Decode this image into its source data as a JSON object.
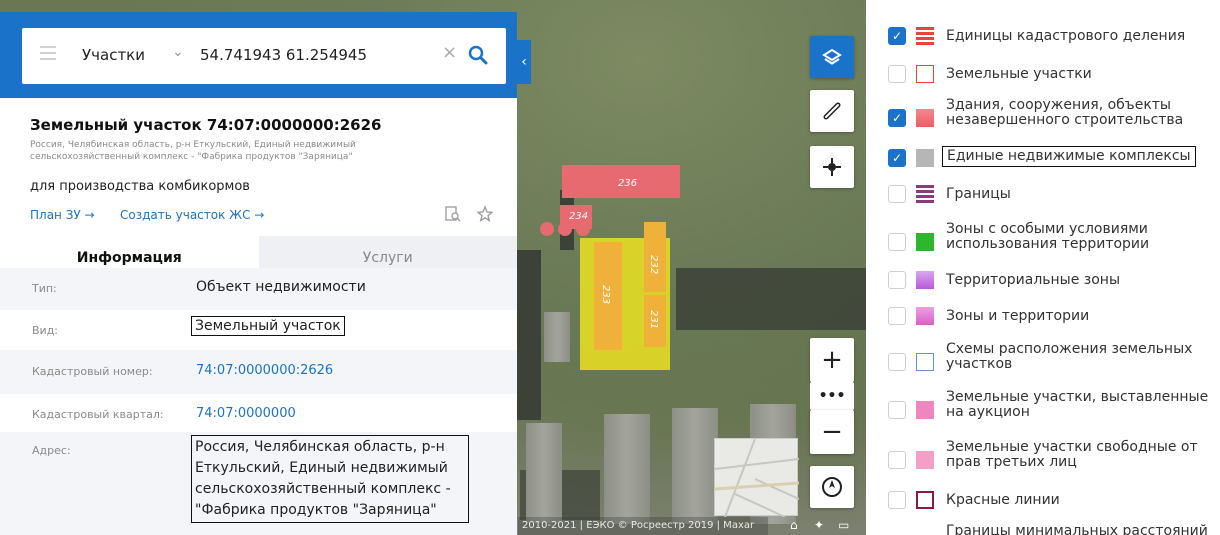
{
  "search": {
    "category": "Участки",
    "query": "54.741943 61.254945"
  },
  "object": {
    "title": "Земельный участок 74:07:0000000:2626",
    "address_short": "Россия, Челябинская область, р-н Еткульский, Единый недвижимый сельскохозяйственный комплекс - \"Фабрика продуктов \"Заряница\"",
    "purpose": "для производства комбикормов",
    "link_plan": "План ЗУ →",
    "link_create": "Создать участок ЖС →"
  },
  "tabs": [
    {
      "label": "Информация"
    },
    {
      "label": "Услуги"
    }
  ],
  "info": [
    {
      "label": "Тип:",
      "value": "Объект недвижимости"
    },
    {
      "label": "Вид:",
      "value": "Земельный участок"
    },
    {
      "label": "Кадастровый номер:",
      "value": "74:07:0000000:2626"
    },
    {
      "label": "Кадастровый квартал:",
      "value": "74:07:0000000"
    },
    {
      "label": "Адрес:",
      "value": "Россия, Челябинская область, р-н Еткульский, Единый недвижимый сельскохозяйственный комплекс - \"Фабрика продуктов \"Заряница\""
    }
  ],
  "map": {
    "labels": [
      "236",
      "234",
      "233",
      "232",
      "231"
    ],
    "attribution": "2010-2021 | ЕЭКО © Росреестр 2019 | Maxar"
  },
  "layers": [
    {
      "label": "Единицы кадастрового деления",
      "checked": true,
      "color": "#e8433d"
    },
    {
      "label": "Земельные участки",
      "checked": false,
      "color": "#e8433d"
    },
    {
      "label": "Здания, сооружения, объекты незавершенного строительства",
      "checked": true,
      "color": "#f05a63"
    },
    {
      "label": "Единые недвижимые комплексы",
      "checked": true,
      "color": "#b6b6b6"
    },
    {
      "label": "Границы",
      "checked": false,
      "color": "#8e3a7a"
    },
    {
      "label": "Зоны с особыми условиями использования территории",
      "checked": false,
      "color": "#2eb62e"
    },
    {
      "label": "Территориальные зоны",
      "checked": false,
      "color": "#b85ad9"
    },
    {
      "label": "Зоны и территории",
      "checked": false,
      "color": "#d662c8"
    },
    {
      "label": "Схемы расположения земельных участков",
      "checked": false,
      "color": "#6a8fd6"
    },
    {
      "label": "Земельные участки, выставленные на аукцион",
      "checked": false,
      "color": "#ef86bf"
    },
    {
      "label": "Земельные участки свободные от прав третьих лиц",
      "checked": false,
      "color": "#f4a0c6"
    },
    {
      "label": "Красные линии",
      "checked": false,
      "color": "#8a1b3b"
    },
    {
      "label": "Границы минимальных расстояний",
      "checked": false,
      "color": "#999999"
    }
  ],
  "colors": {
    "accent": "#1a73c8"
  }
}
